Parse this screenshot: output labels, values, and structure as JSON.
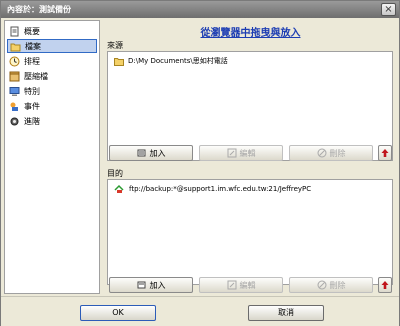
{
  "window": {
    "title": "內容於：測試備份",
    "close_symbol": "×"
  },
  "sidebar": {
    "items": [
      {
        "label": "概要",
        "icon": "document-icon"
      },
      {
        "label": "檔案",
        "icon": "folder-icon"
      },
      {
        "label": "排程",
        "icon": "clock-icon"
      },
      {
        "label": "壓縮檔",
        "icon": "archive-icon"
      },
      {
        "label": "特別",
        "icon": "computer-icon"
      },
      {
        "label": "事件",
        "icon": "event-icon"
      },
      {
        "label": "進階",
        "icon": "advanced-icon"
      }
    ],
    "selected_index": 1
  },
  "main": {
    "drag_hint": "從瀏覽器中拖曳與放入",
    "source": {
      "label": "來源",
      "items": [
        {
          "path": "D:\\My Documents\\思如村電話",
          "icon": "folder-icon"
        }
      ],
      "buttons": {
        "add": "加入",
        "edit": "編輯",
        "delete": "刪除"
      }
    },
    "destination": {
      "label": "目的",
      "items": [
        {
          "path": "ftp://backup:*@support1.im.wfc.edu.tw:21/JeffreyPC",
          "icon": "ftp-icon"
        }
      ],
      "buttons": {
        "add": "加入",
        "edit": "編輯",
        "delete": "刪除"
      }
    }
  },
  "footer": {
    "ok": "OK",
    "cancel": "取消"
  },
  "colors": {
    "link_blue": "#1c3db3",
    "selection": "#c1d2ee",
    "up_arrow_red": "#c0141c"
  }
}
